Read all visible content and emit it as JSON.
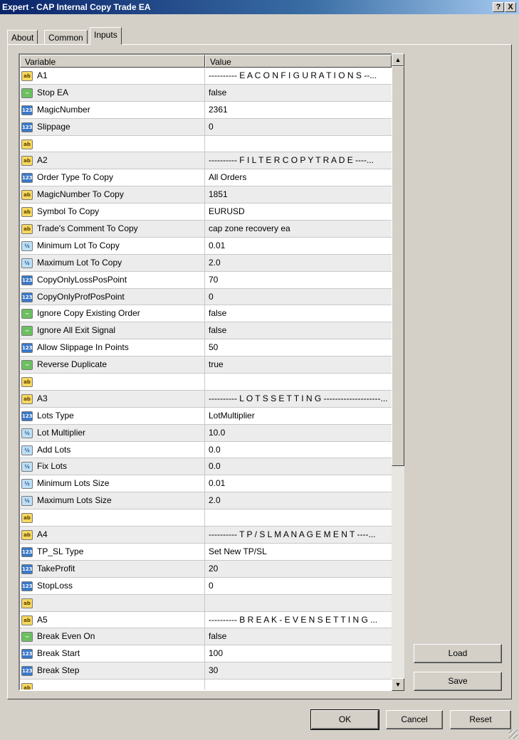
{
  "window": {
    "title": "Expert - CAP Internal Copy Trade EA",
    "help_label": "?",
    "close_label": "X"
  },
  "tabs": [
    {
      "label": "About"
    },
    {
      "label": "Common"
    },
    {
      "label": "Inputs"
    }
  ],
  "table": {
    "headers": [
      "Variable",
      "Value"
    ],
    "rows": [
      {
        "icon": "ab",
        "name": "A1",
        "value": "---------- E A   C O N F I G U R A T I O N S --..."
      },
      {
        "icon": "bool",
        "name": "Stop EA",
        "value": "false"
      },
      {
        "icon": "int",
        "name": "MagicNumber",
        "value": "2361"
      },
      {
        "icon": "int",
        "name": "Slippage",
        "value": "0"
      },
      {
        "icon": "ab",
        "name": "",
        "value": ""
      },
      {
        "icon": "ab",
        "name": "A2",
        "value": "---------- F I L T E R   C O P Y   T R A D E ----..."
      },
      {
        "icon": "int",
        "name": "Order Type To Copy",
        "value": "All Orders"
      },
      {
        "icon": "ab",
        "name": "MagicNumber To Copy",
        "value": "1851"
      },
      {
        "icon": "ab",
        "name": "Symbol To Copy",
        "value": "EURUSD"
      },
      {
        "icon": "ab",
        "name": "Trade's Comment To Copy",
        "value": "cap zone recovery ea"
      },
      {
        "icon": "dbl",
        "name": "Minimum Lot To Copy",
        "value": "0.01"
      },
      {
        "icon": "dbl",
        "name": "Maximum Lot To Copy",
        "value": "2.0"
      },
      {
        "icon": "int",
        "name": "CopyOnlyLossPosPoint",
        "value": "70"
      },
      {
        "icon": "int",
        "name": "CopyOnlyProfPosPoint",
        "value": "0"
      },
      {
        "icon": "bool",
        "name": "Ignore Copy Existing Order",
        "value": "false"
      },
      {
        "icon": "bool",
        "name": "Ignore All Exit Signal",
        "value": "false"
      },
      {
        "icon": "int",
        "name": "Allow Slippage In Points",
        "value": "50"
      },
      {
        "icon": "bool",
        "name": "Reverse Duplicate",
        "value": "true"
      },
      {
        "icon": "ab",
        "name": "",
        "value": ""
      },
      {
        "icon": "ab",
        "name": "A3",
        "value": "---------- L O T S   S E T T I N G --------------------..."
      },
      {
        "icon": "int",
        "name": "Lots Type",
        "value": "LotMultiplier"
      },
      {
        "icon": "dbl",
        "name": "Lot Multiplier",
        "value": "10.0"
      },
      {
        "icon": "dbl",
        "name": "Add Lots",
        "value": "0.0"
      },
      {
        "icon": "dbl",
        "name": "Fix Lots",
        "value": "0.0"
      },
      {
        "icon": "dbl",
        "name": "Minimum Lots Size",
        "value": "0.01"
      },
      {
        "icon": "dbl",
        "name": "Maximum Lots Size",
        "value": "2.0"
      },
      {
        "icon": "ab",
        "name": "",
        "value": ""
      },
      {
        "icon": "ab",
        "name": "A4",
        "value": "---------- T P / S L   M A N A G E M E N T ----..."
      },
      {
        "icon": "int",
        "name": "TP_SL Type",
        "value": "Set New TP/SL"
      },
      {
        "icon": "int",
        "name": "TakeProfit",
        "value": "20"
      },
      {
        "icon": "int",
        "name": "StopLoss",
        "value": "0"
      },
      {
        "icon": "ab",
        "name": "",
        "value": ""
      },
      {
        "icon": "ab",
        "name": "A5",
        "value": "---------- B R E A K - E V E N   S E T T I N G ..."
      },
      {
        "icon": "bool",
        "name": "Break Even On",
        "value": "false"
      },
      {
        "icon": "int",
        "name": "Break Start",
        "value": "100"
      },
      {
        "icon": "int",
        "name": "Break Step",
        "value": "30"
      },
      {
        "icon": "ab",
        "name": "",
        "value": ""
      }
    ]
  },
  "icon_glyphs": {
    "ab": "ab",
    "bool": "~",
    "int": "123",
    "dbl": "½"
  },
  "buttons": {
    "load": "Load",
    "save": "Save",
    "ok": "OK",
    "cancel": "Cancel",
    "reset": "Reset"
  }
}
